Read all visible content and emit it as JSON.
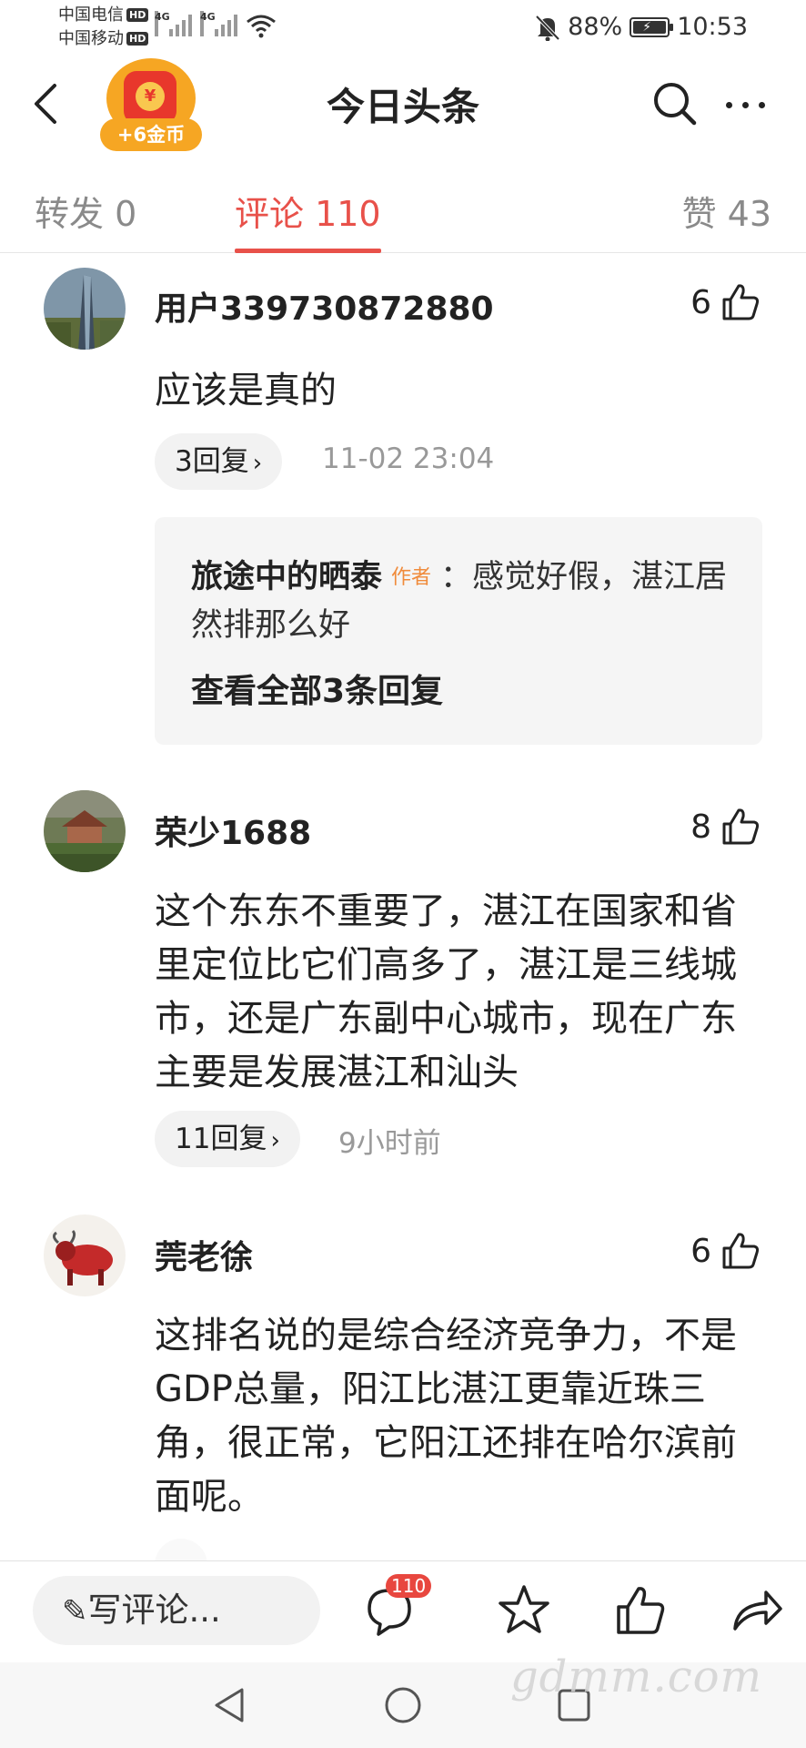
{
  "status_bar": {
    "carrier1": "中国电信",
    "carrier2": "中国移动",
    "hd": "HD",
    "net1": "4G",
    "net2": "4G",
    "battery": "88%",
    "time": "10:53"
  },
  "header": {
    "title": "今日头条",
    "coin_badge": "+6金币",
    "coin_symbol": "¥"
  },
  "tabs": [
    {
      "label": "转发 0",
      "active": false
    },
    {
      "label": "评论 110",
      "active": true
    },
    {
      "label": "赞 43",
      "active": false
    }
  ],
  "comments": [
    {
      "user": "用户339730872880",
      "likes": "6",
      "text": "应该是真的",
      "replies": "3回复",
      "time": "11-02 23:04",
      "quote": {
        "name": "旅途中的晒泰",
        "tag": "作者",
        "text": "：感觉好假，湛江居然排那么好",
        "view_all": "查看全部3条回复"
      }
    },
    {
      "user": "荣少1688",
      "likes": "8",
      "text": "这个东东不重要了，湛江在国家和省里定位比它们高多了，湛江是三线城市，还是广东副中心城市，现在广东主要是发展湛江和汕头",
      "replies": "11回复",
      "time": "9小时前"
    },
    {
      "user": "莞老徐",
      "likes": "6",
      "text": "这排名说的是综合经济竞争力，不是GDP总量，阳江比湛江更靠近珠三角，很正常，它阳江还排在哈尔滨前面呢。"
    }
  ],
  "bottom_bar": {
    "write_placeholder": "写评论...",
    "comment_count": "110"
  },
  "watermark": "gdmm.com"
}
